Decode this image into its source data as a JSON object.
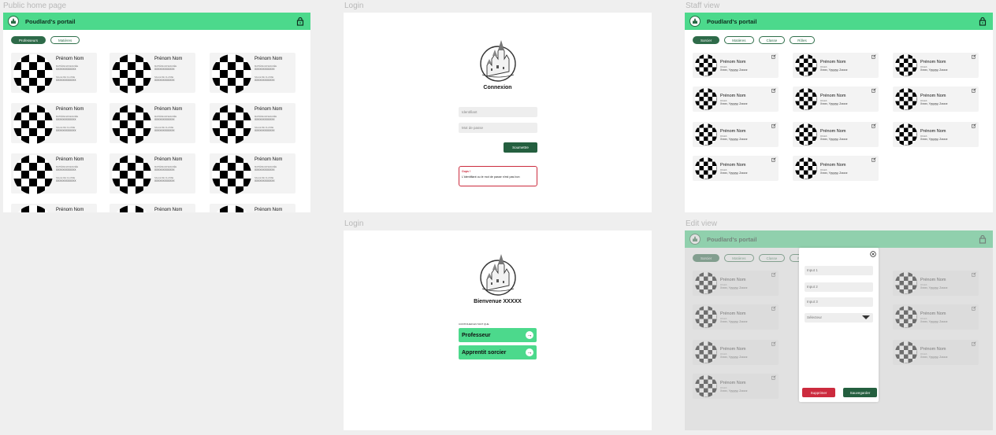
{
  "frames": {
    "public_label": "Public home page",
    "login1_label": "Login",
    "staff_label": "Staff view",
    "login2_label": "Login",
    "edit_label": "Edit view"
  },
  "header": {
    "title": "Poudlard's portail"
  },
  "public": {
    "tabs": [
      "Professeurs",
      "Matières"
    ],
    "card": {
      "name": "Prénom Nom",
      "field1_label": "MATIÈRE ENSEIGNÉE",
      "field1_value": "XXXXXXXXXXXX",
      "field2_label": "SALLE DE CLASSE",
      "field2_value": "XXXXXXXXXXXX"
    }
  },
  "staff": {
    "tabs": [
      "Sorcier",
      "Matières",
      "Classe",
      "Rôles"
    ],
    "card": {
      "name": "Prénom Nom",
      "label": "ROLES",
      "value": "Xxxxx, Yyyyyyy, Zzzzzz"
    }
  },
  "login1": {
    "title": "Connexion",
    "identifier_placeholder": "Identifiant",
    "password_placeholder": "Mot de passe",
    "submit": "Soumettre",
    "error_title": "Oups !",
    "error_message": "L'identifiant ou le mot de passe n'est pas bon"
  },
  "login2": {
    "title": "Bienvenue XXXXX",
    "continue_label": "CONTINUER EN TANT QUE",
    "choice1": "Professeur",
    "choice2": "Apprentit sorcier"
  },
  "edit": {
    "input1": "Input 1",
    "input2": "Input 2",
    "input3": "Input 3",
    "selector": "Sélecteur",
    "delete": "Supprimer",
    "save": "Sauvegarder"
  },
  "colors": {
    "green": "#4cd98c",
    "dark_green": "#245f3f",
    "red": "#cc2b3e"
  }
}
